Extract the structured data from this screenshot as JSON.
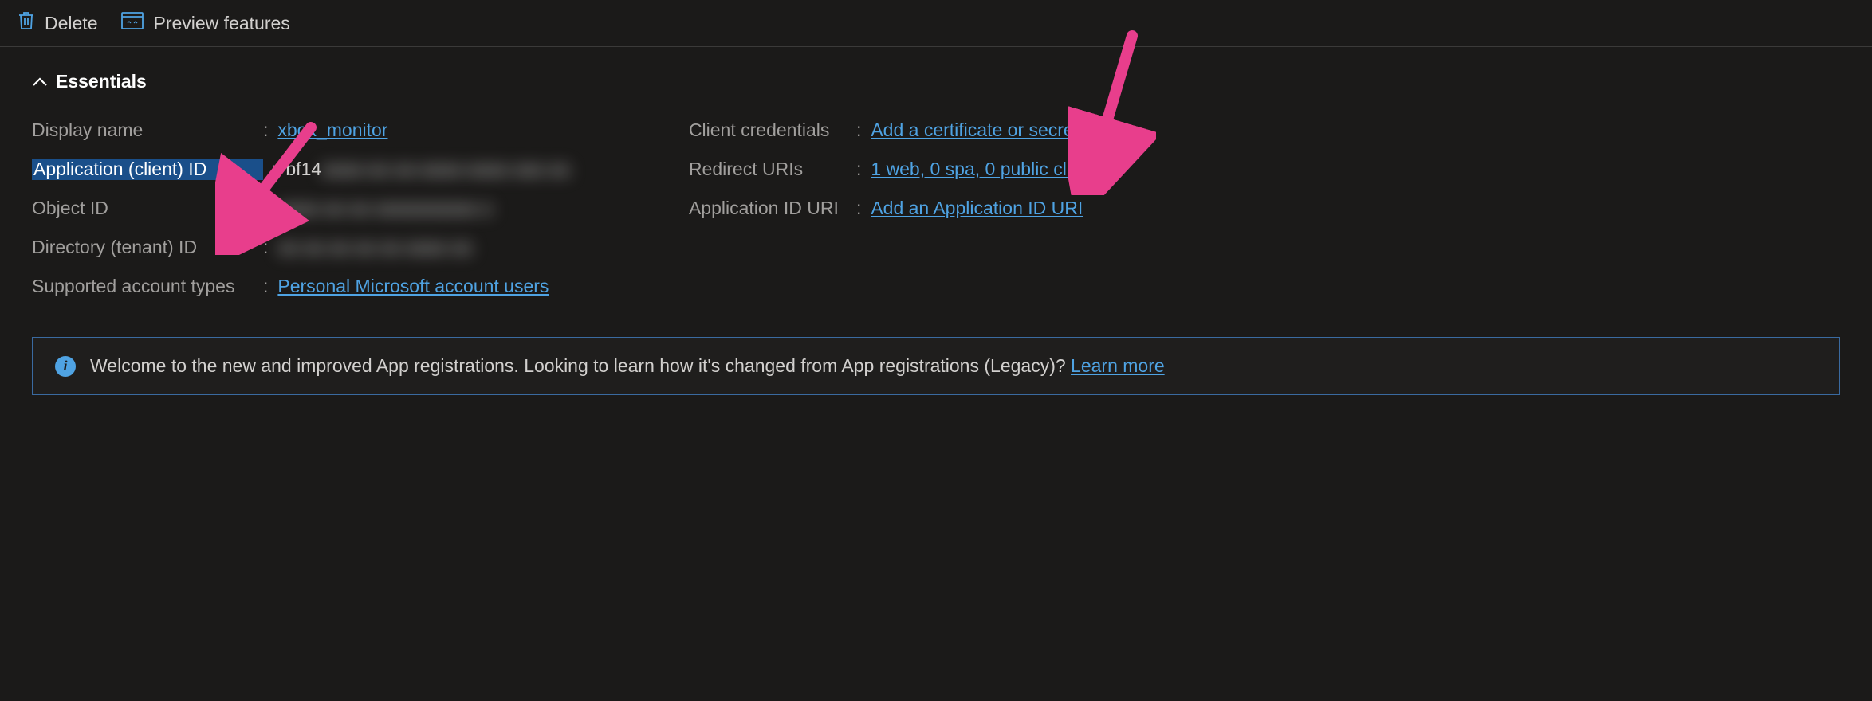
{
  "toolbar": {
    "delete_label": "Delete",
    "preview_label": "Preview features"
  },
  "section": {
    "title": "Essentials"
  },
  "left": {
    "display_name_label": "Display name",
    "display_name_value": "xbox_monitor",
    "app_id_label": "Application (client) ID",
    "app_id_prefix": "bf14",
    "app_id_masked": "aaaa-aa aa-aaaa-aaaa aaa aa",
    "object_id_label": "Object ID",
    "object_id_masked": "aaaa aa aa aaaaaaaaaa a",
    "tenant_id_label": "Directory (tenant) ID",
    "tenant_id_masked": "aa aa aa aa aa aaaa aa",
    "supported_label": "Supported account types",
    "supported_value": "Personal Microsoft account users"
  },
  "right": {
    "credentials_label": "Client credentials",
    "credentials_value": "Add a certificate or secret",
    "redirect_label": "Redirect URIs",
    "redirect_value": "1 web, 0 spa, 0 public client",
    "appiduri_label": "Application ID URI",
    "appiduri_value": "Add an Application ID URI"
  },
  "banner": {
    "text": "Welcome to the new and improved App registrations. Looking to learn how it's changed from App registrations (Legacy)? ",
    "link": "Learn more"
  }
}
